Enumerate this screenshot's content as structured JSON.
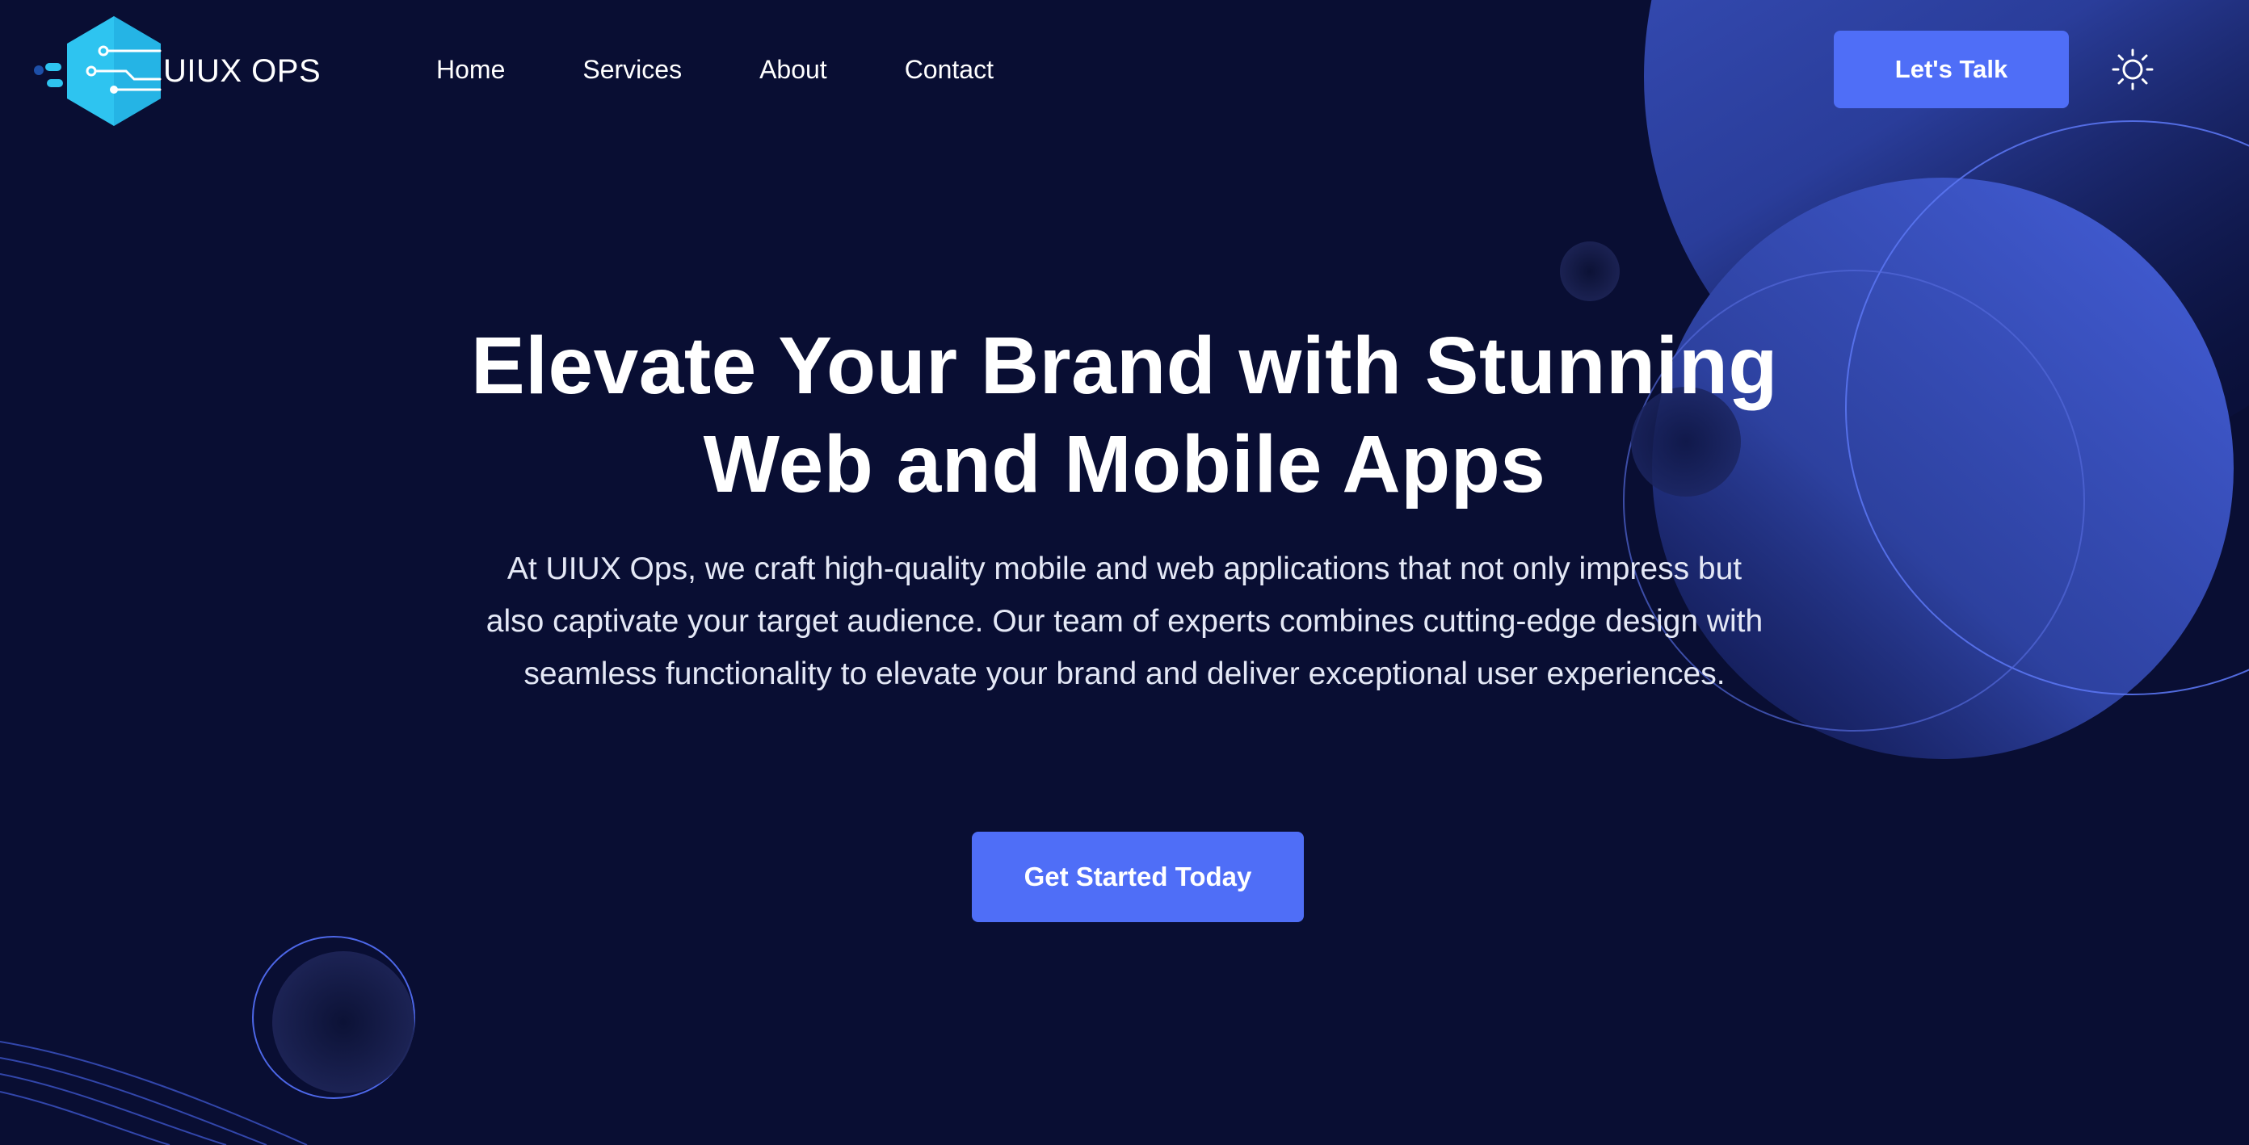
{
  "brand": {
    "name": "UIUX OPS",
    "logo_icon": "hexagon-circuit-icon",
    "logo_color": "#2ec4f0"
  },
  "nav": {
    "items": [
      {
        "label": "Home"
      },
      {
        "label": "Services"
      },
      {
        "label": "About"
      },
      {
        "label": "Contact"
      }
    ]
  },
  "header": {
    "cta_label": "Let's Talk",
    "theme_icon": "sun-icon"
  },
  "hero": {
    "title_line1": "Elevate Your Brand with Stunning",
    "title_line2": "Web and Mobile Apps",
    "description": "At UIUX Ops, we craft high-quality mobile and web applications that not only impress but also captivate your target audience. Our team of experts combines cutting-edge design with seamless functionality to elevate your brand and deliver exceptional user experiences.",
    "cta_label": "Get Started Today"
  },
  "colors": {
    "background": "#090e33",
    "accent": "#4f6ef7",
    "text": "#ffffff"
  }
}
